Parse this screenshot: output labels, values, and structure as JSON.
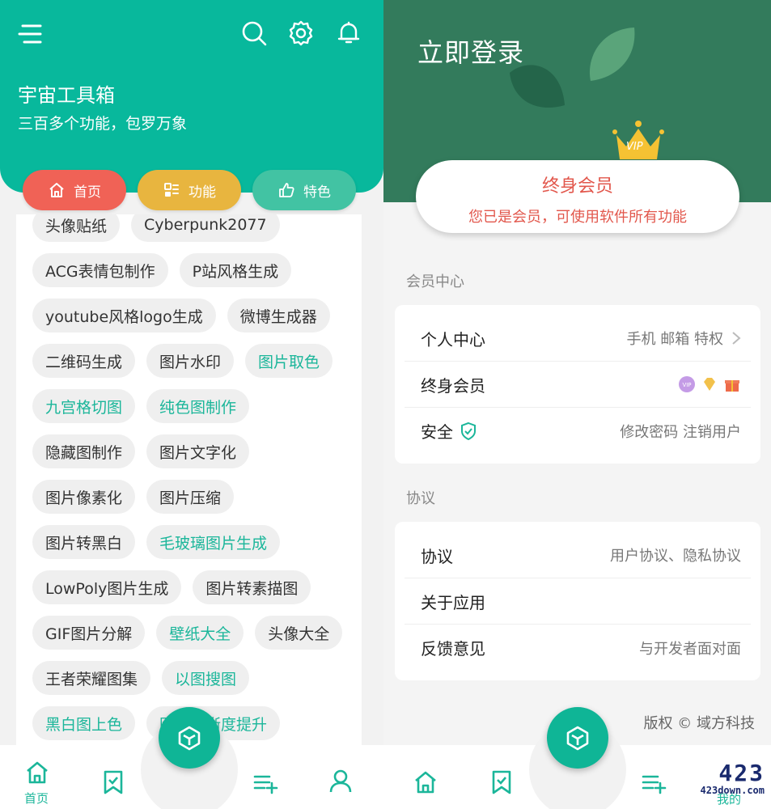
{
  "left": {
    "app_title": "宇宙工具箱",
    "app_subtitle": "三百多个功能，包罗万象",
    "tabs": [
      "首页",
      "功能",
      "特色"
    ],
    "chip_rows": [
      [
        {
          "label": "头像贴纸",
          "hl": false
        },
        {
          "label": "Cyberpunk2077",
          "hl": false
        }
      ],
      [
        {
          "label": "ACG表情包制作",
          "hl": false
        },
        {
          "label": "P站风格生成",
          "hl": false
        }
      ],
      [
        {
          "label": "youtube风格logo生成",
          "hl": false
        },
        {
          "label": "微博生成器",
          "hl": false
        }
      ],
      [
        {
          "label": "二维码生成",
          "hl": false
        },
        {
          "label": "图片水印",
          "hl": false
        },
        {
          "label": "图片取色",
          "hl": true
        }
      ],
      [
        {
          "label": "九宫格切图",
          "hl": true
        },
        {
          "label": "纯色图制作",
          "hl": true
        }
      ],
      [
        {
          "label": "隐藏图制作",
          "hl": false
        },
        {
          "label": "图片文字化",
          "hl": false
        }
      ],
      [
        {
          "label": "图片像素化",
          "hl": false
        },
        {
          "label": "图片压缩",
          "hl": false
        }
      ],
      [
        {
          "label": "图片转黑白",
          "hl": false
        },
        {
          "label": "毛玻璃图片生成",
          "hl": true
        }
      ],
      [
        {
          "label": "LowPoly图片生成",
          "hl": false
        },
        {
          "label": "图片转素描图",
          "hl": false
        }
      ],
      [
        {
          "label": "GIF图片分解",
          "hl": false
        },
        {
          "label": "壁纸大全",
          "hl": true
        },
        {
          "label": "头像大全",
          "hl": false
        }
      ],
      [
        {
          "label": "王者荣耀图集",
          "hl": false
        },
        {
          "label": "以图搜图",
          "hl": true
        }
      ],
      [
        {
          "label": "黑白图上色",
          "hl": true
        },
        {
          "label": "图片清晰度提升",
          "hl": true
        }
      ]
    ],
    "nav_home_label": "首页"
  },
  "right": {
    "login_title": "立即登录",
    "vip_badge": "VIP",
    "vip_title": "终身会员",
    "vip_desc": "您已是会员，可使用软件所有功能",
    "section_member": "会员中心",
    "member_rows": [
      {
        "label": "个人中心",
        "right": "手机 邮箱 特权"
      },
      {
        "label": "终身会员",
        "right": ""
      },
      {
        "label": "安全",
        "right": "修改密码  注销用户"
      }
    ],
    "section_agreement": "协议",
    "agreement_rows": [
      {
        "label": "协议",
        "right": "用户协议、隐私协议"
      },
      {
        "label": "关于应用",
        "right": ""
      },
      {
        "label": "反馈意见",
        "right": "与开发者面对面"
      }
    ],
    "copyright": "版权 © 域方科技",
    "nav_mine_label": "我的",
    "watermark_big": "423",
    "watermark_small": "423down.com"
  },
  "colors": {
    "teal": "#08b89c",
    "dark_green": "#337b5c",
    "red": "#f06256",
    "yellow": "#e8b53f",
    "mint": "#42c3a3",
    "vip_text": "#e2574c"
  }
}
